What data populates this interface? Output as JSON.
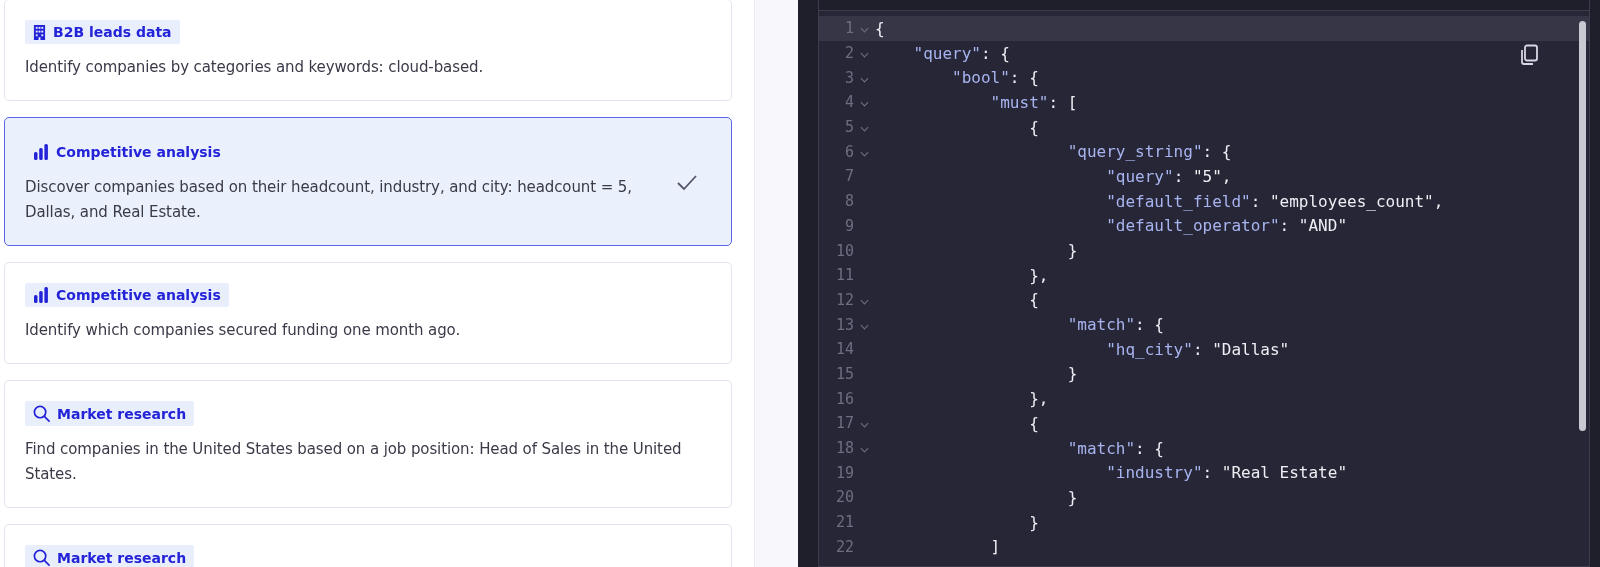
{
  "cards": [
    {
      "tag": {
        "kind": "building",
        "label": "B2B leads data"
      },
      "text": "Identify companies by categories and keywords: cloud-based.",
      "selected": false
    },
    {
      "tag": {
        "kind": "chart",
        "label": "Competitive analysis"
      },
      "text": "Discover companies based on their headcount, industry, and city: headcount = 5, Dallas, and Real Estate.",
      "selected": true
    },
    {
      "tag": {
        "kind": "chart",
        "label": "Competitive analysis"
      },
      "text": "Identify which companies secured funding one month ago.",
      "selected": false
    },
    {
      "tag": {
        "kind": "search",
        "label": "Market research"
      },
      "text": "Find companies in the United States based on a job position: Head of Sales in the United States.",
      "selected": false
    },
    {
      "tag": {
        "kind": "search",
        "label": "Market research"
      },
      "selected": false
    }
  ],
  "editor": {
    "lines": [
      {
        "number": "1",
        "foldable": true,
        "active": true,
        "text": "{"
      },
      {
        "number": "2",
        "foldable": true,
        "active": false,
        "text": "    \"query\": {"
      },
      {
        "number": "3",
        "foldable": true,
        "active": false,
        "text": "        \"bool\": {"
      },
      {
        "number": "4",
        "foldable": true,
        "active": false,
        "text": "            \"must\": ["
      },
      {
        "number": "5",
        "foldable": true,
        "active": false,
        "text": "                {"
      },
      {
        "number": "6",
        "foldable": true,
        "active": false,
        "text": "                    \"query_string\": {"
      },
      {
        "number": "7",
        "foldable": false,
        "active": false,
        "text": "                        \"query\": \"5\","
      },
      {
        "number": "8",
        "foldable": false,
        "active": false,
        "text": "                        \"default_field\": \"employees_count\","
      },
      {
        "number": "9",
        "foldable": false,
        "active": false,
        "text": "                        \"default_operator\": \"AND\""
      },
      {
        "number": "10",
        "foldable": false,
        "active": false,
        "text": "                    }"
      },
      {
        "number": "11",
        "foldable": false,
        "active": false,
        "text": "                },"
      },
      {
        "number": "12",
        "foldable": true,
        "active": false,
        "text": "                {"
      },
      {
        "number": "13",
        "foldable": true,
        "active": false,
        "text": "                    \"match\": {"
      },
      {
        "number": "14",
        "foldable": false,
        "active": false,
        "text": "                        \"hq_city\": \"Dallas\""
      },
      {
        "number": "15",
        "foldable": false,
        "active": false,
        "text": "                    }"
      },
      {
        "number": "16",
        "foldable": false,
        "active": false,
        "text": "                },"
      },
      {
        "number": "17",
        "foldable": true,
        "active": false,
        "text": "                {"
      },
      {
        "number": "18",
        "foldable": true,
        "active": false,
        "text": "                    \"match\": {"
      },
      {
        "number": "19",
        "foldable": false,
        "active": false,
        "text": "                        \"industry\": \"Real Estate\""
      },
      {
        "number": "20",
        "foldable": false,
        "active": false,
        "text": "                    }"
      },
      {
        "number": "21",
        "foldable": false,
        "active": false,
        "text": "                }"
      },
      {
        "number": "22",
        "foldable": false,
        "active": false,
        "text": "            ]"
      }
    ]
  }
}
